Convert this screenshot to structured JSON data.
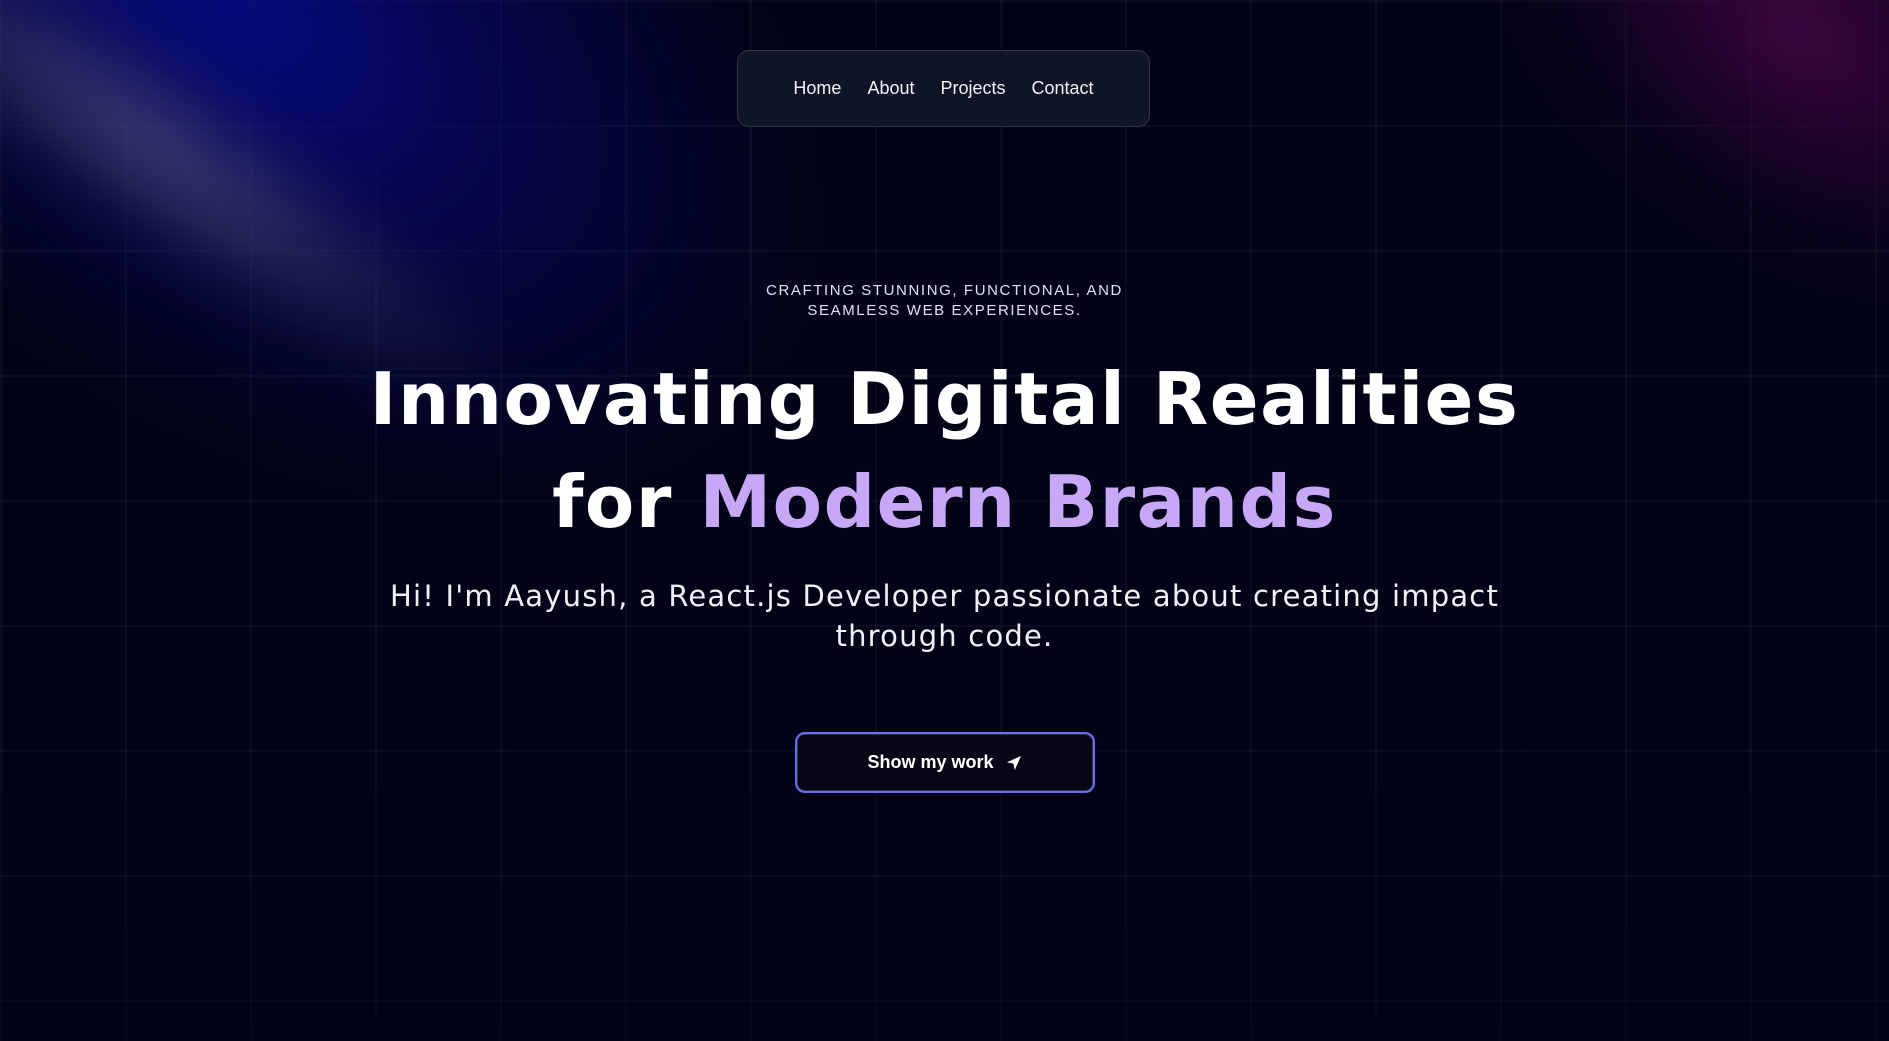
{
  "nav": {
    "items": [
      {
        "label": "Home"
      },
      {
        "label": "About"
      },
      {
        "label": "Projects"
      },
      {
        "label": "Contact"
      }
    ]
  },
  "hero": {
    "tagline": "CRAFTING STUNNING, FUNCTIONAL, AND SEAMLESS WEB EXPERIENCES.",
    "headline_line1": "Innovating Digital Realities",
    "headline_line2_prefix": "for ",
    "headline_line2_accent": "Modern Brands",
    "intro": "Hi! I'm Aayush, a React.js Developer passionate about creating impact through code.",
    "cta_label": "Show my work",
    "cta_icon": "location-arrow-icon"
  },
  "colors": {
    "background": "#030318",
    "accent_text": "#c6a8f7",
    "cta_border": "#6c6cf0",
    "spotlight_blue": "#080c96",
    "spotlight_purple": "#460546"
  }
}
